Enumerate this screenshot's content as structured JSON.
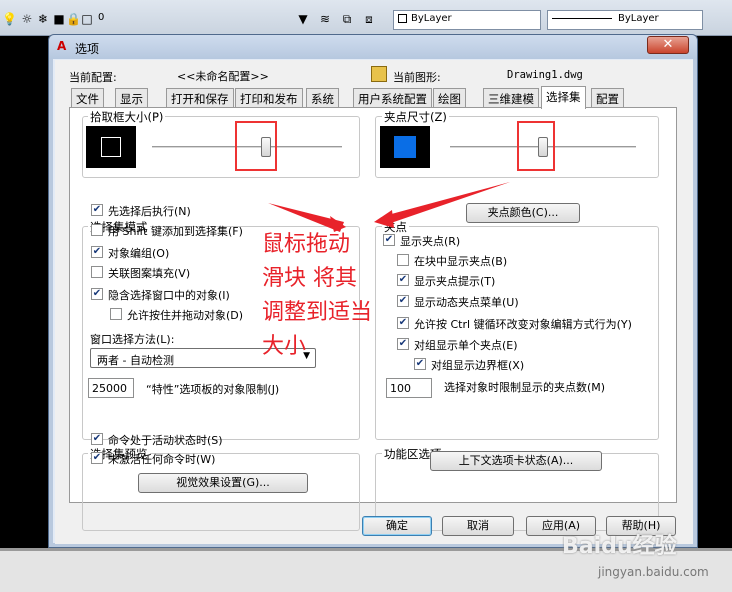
{
  "toolbar": {
    "layer_value": "0",
    "color_combo": "ByLayer",
    "linetype_combo": "ByLayer"
  },
  "dialog": {
    "title": "选项",
    "close": "✕",
    "current_profile_label": "当前配置:",
    "current_profile_value": "<<未命名配置>>",
    "current_drawing_label": "当前图形:",
    "current_drawing_value": "Drawing1.dwg",
    "tabs": [
      "文件",
      "显示",
      "打开和保存",
      "打印和发布",
      "系统",
      "用户系统配置",
      "绘图",
      "三维建模",
      "选择集",
      "配置"
    ],
    "active_tab": "选择集",
    "pickbox": {
      "title": "拾取框大小(P)",
      "level": 0.6
    },
    "grip_size": {
      "title": "夹点尺寸(Z)",
      "level": 0.5,
      "swatch_color": "#0a6ee6"
    },
    "selection_modes": {
      "title": "选择集模式",
      "items": [
        {
          "label": "先选择后执行(N)",
          "checked": true
        },
        {
          "label": "用 Shift 键添加到选择集(F)",
          "checked": false
        },
        {
          "label": "对象编组(O)",
          "checked": true
        },
        {
          "label": "关联图案填充(V)",
          "checked": false
        },
        {
          "label": "隐含选择窗口中的对象(I)",
          "checked": true
        },
        {
          "label": "允许按住并拖动对象(D)",
          "checked": false
        }
      ],
      "window_method_label": "窗口选择方法(L):",
      "window_method_value": "两者 - 自动检测",
      "limit_value": "25000",
      "limit_label": "“特性”选项板的对象限制(J)"
    },
    "grips": {
      "title": "夹点",
      "color_button": "夹点颜色(C)...",
      "items": [
        {
          "label": "显示夹点(R)",
          "checked": true
        },
        {
          "label": "在块中显示夹点(B)",
          "checked": false
        },
        {
          "label": "显示夹点提示(T)",
          "checked": true
        },
        {
          "label": "显示动态夹点菜单(U)",
          "checked": true
        },
        {
          "label": "允许按 Ctrl 键循环改变对象编辑方式行为(Y)",
          "checked": true
        },
        {
          "label": "对组显示单个夹点(E)",
          "checked": true
        },
        {
          "label": "对组显示边界框(X)",
          "checked": true
        }
      ],
      "limit_value": "100",
      "limit_label": "选择对象时限制显示的夹点数(M)"
    },
    "preview": {
      "title": "选择集预览",
      "items": [
        {
          "label": "命令处于活动状态时(S)",
          "checked": true
        },
        {
          "label": "未激活任何命令时(W)",
          "checked": true
        }
      ],
      "visual_button": "视觉效果设置(G)..."
    },
    "ribbon": {
      "title": "功能区选项",
      "context_button": "上下文选项卡状态(A)..."
    },
    "buttons": {
      "ok": "确定",
      "cancel": "取消",
      "apply": "应用(A)",
      "help": "帮助(H)"
    }
  },
  "annotation": {
    "lines": [
      "鼠标拖动",
      "滑块 将其",
      "调整到适当",
      "大小"
    ],
    "color": "#e8222a"
  },
  "watermark": {
    "brand": "Baidu经验",
    "url": "jingyan.baidu.com"
  }
}
